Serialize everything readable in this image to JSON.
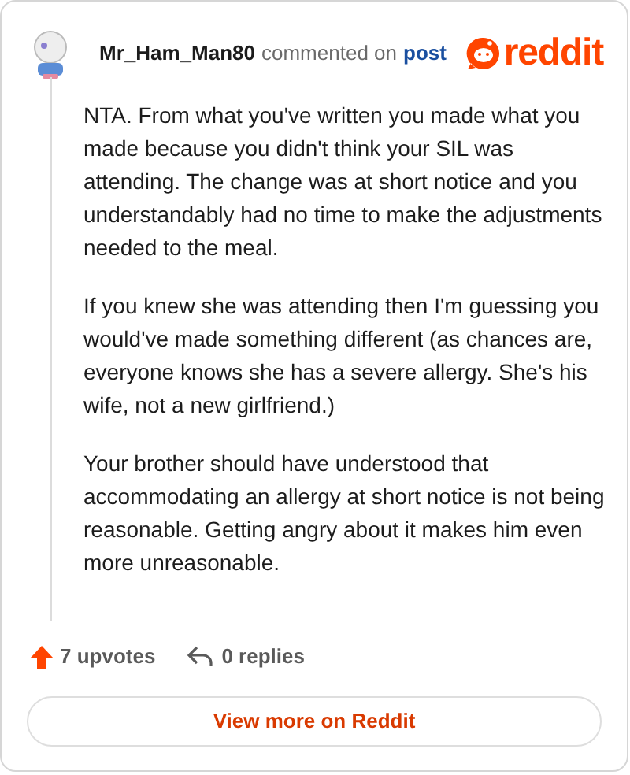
{
  "header": {
    "username": "Mr_Ham_Man80",
    "action": "commented on",
    "link": "post",
    "logo_text": "reddit"
  },
  "paragraphs": [
    "NTA. From what you've written you made what you made because you didn't think your SIL was attending. The change was at short notice and you understandably had no time to make the adjustments needed to the meal.",
    "If you knew she was attending then I'm guessing you would've made something different (as chances are, everyone knows she has a severe allergy. She's his wife, not a new girlfriend.)",
    "Your brother should have understood that accommodating an allergy at short notice is not being reasonable. Getting angry about it makes him even more unreasonable."
  ],
  "footer": {
    "upvotes": "7 upvotes",
    "replies": "0 replies"
  },
  "button": "View more on Reddit"
}
